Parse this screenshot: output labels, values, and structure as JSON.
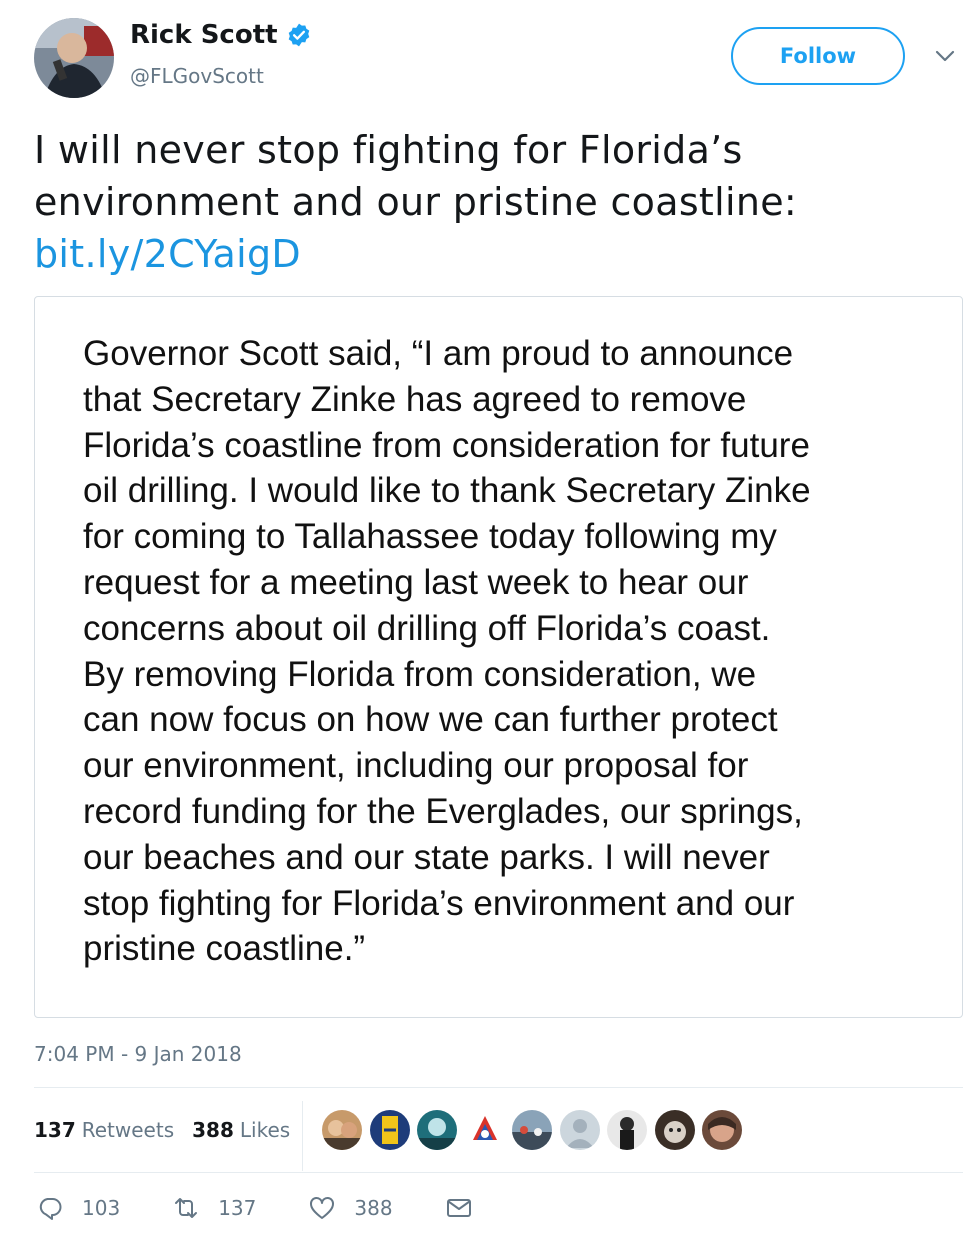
{
  "author": {
    "name": "Rick Scott",
    "handle": "@FLGovScott",
    "verified_color": "#1da1f2"
  },
  "follow_label": "Follow",
  "tweet": {
    "text": "I will never stop fighting for Florida’s environment and our pristine coastline:",
    "link": "bit.ly/2CYaigD"
  },
  "media": {
    "statement": "Governor Scott said, “I am proud to announce\nthat Secretary Zinke has agreed to remove\nFlorida’s coastline from consideration for future\noil drilling. I would like to thank Secretary Zinke\nfor coming to Tallahassee today following my\nrequest for a meeting last week to hear our\nconcerns about oil drilling off Florida’s coast.\nBy removing Florida from consideration, we\ncan now focus on how we can further protect\nour environment, including our proposal for\nrecord funding for the Everglades, our springs,\nour beaches and our state parks. I will never\nstop fighting for Florida’s environment and our\npristine coastline.”"
  },
  "timestamp": "7:04 PM - 9 Jan 2018",
  "stats": {
    "retweets_count": "137",
    "retweets_label": "Retweets",
    "likes_count": "388",
    "likes_label": "Likes"
  },
  "actions": {
    "replies": "103",
    "retweets": "137",
    "likes": "388"
  },
  "colors": {
    "link": "#1b95e0",
    "muted": "#657786",
    "border": "#d6dde3"
  }
}
